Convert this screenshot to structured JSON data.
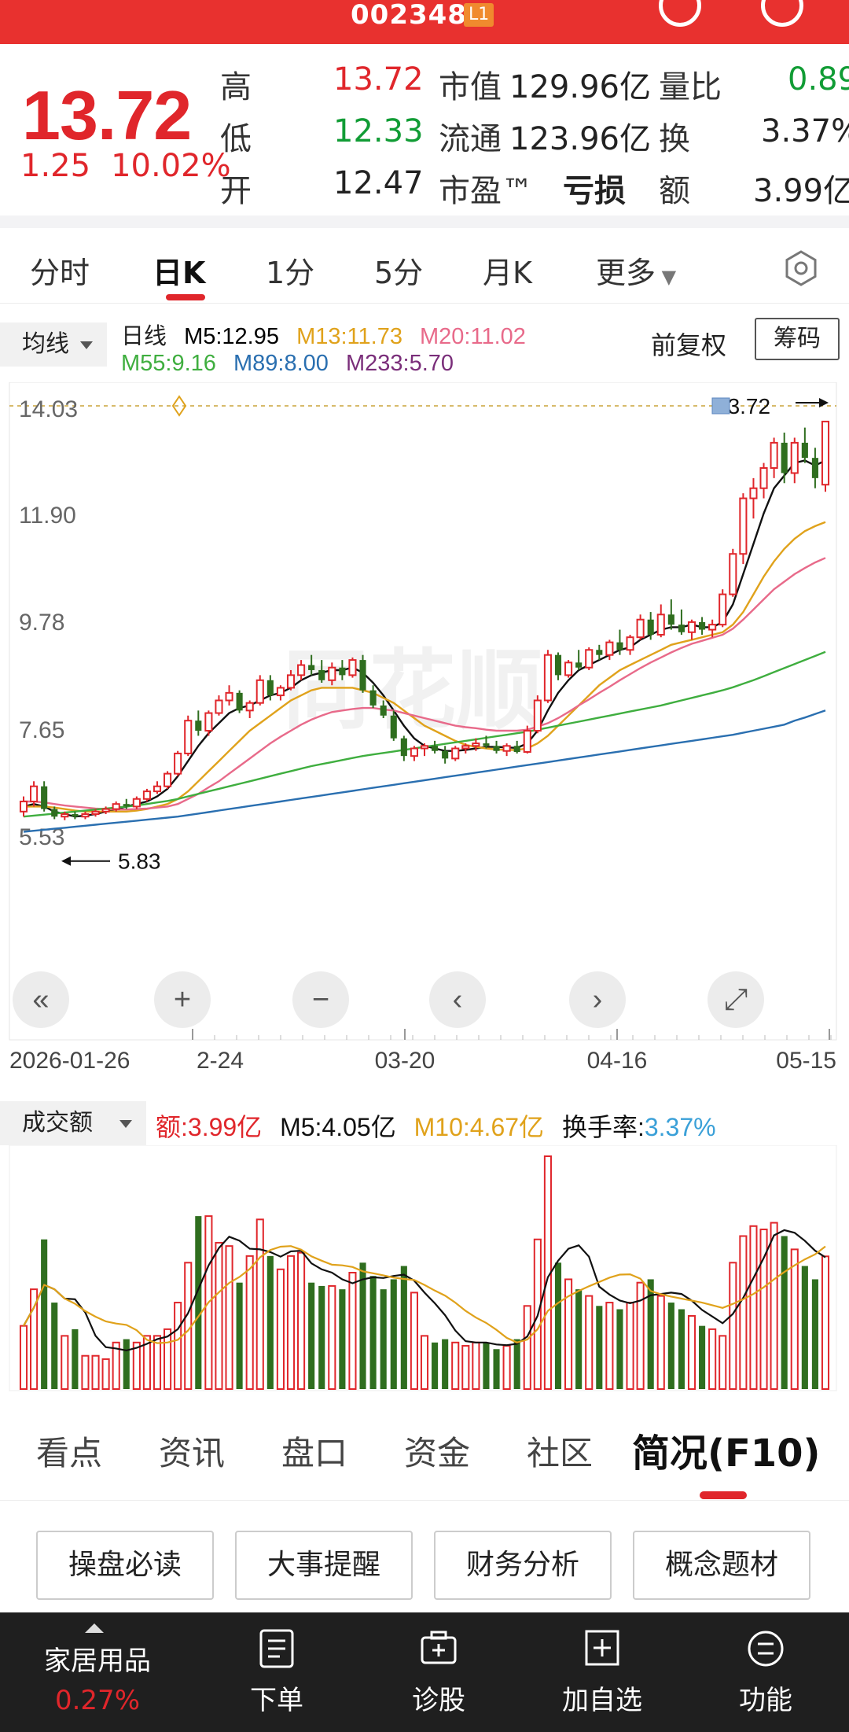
{
  "header": {
    "code": "002348",
    "level_badge": "L1"
  },
  "quote": {
    "price": "13.72",
    "change": "1.25",
    "change_pct": "10.02%",
    "rows": [
      {
        "l1": "高",
        "v1": "13.72",
        "l2": "市值",
        "v2": "129.96亿",
        "l3": "量比",
        "v3": "0.89"
      },
      {
        "l1": "低",
        "v1": "12.33",
        "l2": "流通",
        "v2": "123.96亿",
        "l3": "换",
        "v3": "3.37%"
      },
      {
        "l1": "开",
        "v1": "12.47",
        "l2": "市盈™",
        "v2": "亏损",
        "l3": "额",
        "v3": "3.99亿"
      }
    ]
  },
  "tabs": [
    "分时",
    "日K",
    "1分",
    "5分",
    "月K",
    "更多"
  ],
  "active_tab": "日K",
  "chart_header": {
    "indicator_dropdown": "均线",
    "period_label": "日线",
    "ma": [
      {
        "label": "M5:12.95",
        "color": "#111111"
      },
      {
        "label": "M13:11.73",
        "color": "#e0a21b"
      },
      {
        "label": "M20:11.02",
        "color": "#e86a8a"
      },
      {
        "label": "M55:9.16",
        "color": "#3fae3f"
      },
      {
        "label": "M89:8.00",
        "color": "#2a6fb0"
      },
      {
        "label": "M233:5.70",
        "color": "#7a2e7a"
      }
    ],
    "adjust": "前复权",
    "chips_button": "筹码"
  },
  "chart_data": {
    "type": "candlestick",
    "y_ticks": [
      "14.03",
      "11.90",
      "9.78",
      "7.65",
      "5.53"
    ],
    "x_ticks": [
      "2026-01-26",
      "2-24",
      "03-20",
      "04-16",
      "05-15"
    ],
    "high_label": "13.72",
    "low_label": "5.83",
    "watermark": "同花顺",
    "candles": [
      [
        6.0,
        6.3,
        5.9,
        6.2
      ],
      [
        6.2,
        6.6,
        6.1,
        6.5
      ],
      [
        6.5,
        6.6,
        6.0,
        6.05
      ],
      [
        6.05,
        6.1,
        5.85,
        5.9
      ],
      [
        5.9,
        6.0,
        5.83,
        5.95
      ],
      [
        5.95,
        6.0,
        5.85,
        5.9
      ],
      [
        5.9,
        6.0,
        5.85,
        5.95
      ],
      [
        5.95,
        6.05,
        5.9,
        6.0
      ],
      [
        6.0,
        6.1,
        5.95,
        6.05
      ],
      [
        6.05,
        6.2,
        6.0,
        6.15
      ],
      [
        6.15,
        6.25,
        6.05,
        6.1
      ],
      [
        6.1,
        6.3,
        6.05,
        6.25
      ],
      [
        6.25,
        6.45,
        6.2,
        6.4
      ],
      [
        6.4,
        6.6,
        6.35,
        6.5
      ],
      [
        6.5,
        6.8,
        6.45,
        6.75
      ],
      [
        6.75,
        7.2,
        6.7,
        7.15
      ],
      [
        7.15,
        7.9,
        7.1,
        7.8
      ],
      [
        7.8,
        8.0,
        7.5,
        7.6
      ],
      [
        7.6,
        8.0,
        7.5,
        7.95
      ],
      [
        7.95,
        8.3,
        7.9,
        8.2
      ],
      [
        8.2,
        8.5,
        8.1,
        8.35
      ],
      [
        8.35,
        8.4,
        7.95,
        8.0
      ],
      [
        8.0,
        8.2,
        7.85,
        8.15
      ],
      [
        8.15,
        8.7,
        8.1,
        8.6
      ],
      [
        8.6,
        8.7,
        8.2,
        8.3
      ],
      [
        8.3,
        8.5,
        8.2,
        8.45
      ],
      [
        8.45,
        8.8,
        8.4,
        8.7
      ],
      [
        8.7,
        9.0,
        8.6,
        8.9
      ],
      [
        8.9,
        9.1,
        8.7,
        8.8
      ],
      [
        8.8,
        9.0,
        8.55,
        8.6
      ],
      [
        8.6,
        8.95,
        8.5,
        8.85
      ],
      [
        8.85,
        9.0,
        8.6,
        8.7
      ],
      [
        8.7,
        9.05,
        8.65,
        9.0
      ],
      [
        9.0,
        9.1,
        8.35,
        8.4
      ],
      [
        8.4,
        8.5,
        8.05,
        8.1
      ],
      [
        8.1,
        8.2,
        7.85,
        7.9
      ],
      [
        7.9,
        8.0,
        7.4,
        7.45
      ],
      [
        7.45,
        7.5,
        7.0,
        7.1
      ],
      [
        7.1,
        7.3,
        7.0,
        7.25
      ],
      [
        7.25,
        7.35,
        7.1,
        7.3
      ],
      [
        7.3,
        7.4,
        7.15,
        7.2
      ],
      [
        7.2,
        7.3,
        6.95,
        7.05
      ],
      [
        7.05,
        7.3,
        7.0,
        7.25
      ],
      [
        7.25,
        7.35,
        7.15,
        7.3
      ],
      [
        7.3,
        7.45,
        7.2,
        7.35
      ],
      [
        7.35,
        7.5,
        7.25,
        7.3
      ],
      [
        7.3,
        7.4,
        7.15,
        7.2
      ],
      [
        7.2,
        7.35,
        7.1,
        7.3
      ],
      [
        7.3,
        7.4,
        7.15,
        7.18
      ],
      [
        7.18,
        7.7,
        7.15,
        7.6
      ],
      [
        7.6,
        8.3,
        7.55,
        8.2
      ],
      [
        8.2,
        9.2,
        8.15,
        9.1
      ],
      [
        9.1,
        9.15,
        8.6,
        8.7
      ],
      [
        8.7,
        9.0,
        8.65,
        8.95
      ],
      [
        8.95,
        9.2,
        8.8,
        8.85
      ],
      [
        8.85,
        9.25,
        8.8,
        9.2
      ],
      [
        9.2,
        9.3,
        9.0,
        9.1
      ],
      [
        9.1,
        9.4,
        9.0,
        9.35
      ],
      [
        9.35,
        9.6,
        9.1,
        9.2
      ],
      [
        9.2,
        9.5,
        9.1,
        9.45
      ],
      [
        9.45,
        9.9,
        9.4,
        9.8
      ],
      [
        9.8,
        9.95,
        9.4,
        9.5
      ],
      [
        9.5,
        10.1,
        9.45,
        9.9
      ],
      [
        9.9,
        10.2,
        9.6,
        9.7
      ],
      [
        9.7,
        10.0,
        9.5,
        9.55
      ],
      [
        9.55,
        9.8,
        9.4,
        9.75
      ],
      [
        9.75,
        9.85,
        9.5,
        9.6
      ],
      [
        9.6,
        9.8,
        9.45,
        9.7
      ],
      [
        9.7,
        10.4,
        9.65,
        10.3
      ],
      [
        10.3,
        11.2,
        10.25,
        11.1
      ],
      [
        11.1,
        12.3,
        10.9,
        12.2
      ],
      [
        12.2,
        12.6,
        11.8,
        12.4
      ],
      [
        12.4,
        12.9,
        12.2,
        12.8
      ],
      [
        12.8,
        13.4,
        12.6,
        13.3
      ],
      [
        13.3,
        13.5,
        12.5,
        12.7
      ],
      [
        12.7,
        13.4,
        12.5,
        13.3
      ],
      [
        13.3,
        13.6,
        12.9,
        13.0
      ],
      [
        13.0,
        13.2,
        12.4,
        12.6
      ],
      [
        12.47,
        13.72,
        12.33,
        13.72
      ]
    ],
    "ma_series": {
      "M5": [
        6.1,
        6.15,
        6.1,
        6.0,
        5.95,
        5.9,
        5.92,
        5.95,
        6.0,
        6.05,
        6.1,
        6.15,
        6.2,
        6.3,
        6.45,
        6.7,
        7.0,
        7.3,
        7.55,
        7.75,
        7.95,
        8.05,
        8.1,
        8.2,
        8.3,
        8.35,
        8.45,
        8.6,
        8.7,
        8.75,
        8.8,
        8.8,
        8.85,
        8.75,
        8.55,
        8.3,
        8.0,
        7.7,
        7.45,
        7.3,
        7.25,
        7.2,
        7.2,
        7.22,
        7.25,
        7.28,
        7.28,
        7.27,
        7.26,
        7.35,
        7.6,
        8.0,
        8.35,
        8.6,
        8.8,
        8.9,
        9.0,
        9.1,
        9.2,
        9.25,
        9.4,
        9.5,
        9.6,
        9.65,
        9.65,
        9.7,
        9.65,
        9.65,
        9.75,
        10.1,
        10.7,
        11.3,
        11.9,
        12.4,
        12.65,
        12.9,
        12.95,
        12.85,
        12.95
      ],
      "M13": [
        6.1,
        6.1,
        6.1,
        6.08,
        6.05,
        6.02,
        6.0,
        6.0,
        6.0,
        6.0,
        6.0,
        6.02,
        6.05,
        6.1,
        6.15,
        6.25,
        6.4,
        6.6,
        6.8,
        7.0,
        7.2,
        7.4,
        7.6,
        7.75,
        7.9,
        8.05,
        8.2,
        8.3,
        8.4,
        8.45,
        8.45,
        8.45,
        8.45,
        8.4,
        8.35,
        8.25,
        8.15,
        8.0,
        7.85,
        7.7,
        7.6,
        7.5,
        7.4,
        7.32,
        7.28,
        7.25,
        7.23,
        7.22,
        7.22,
        7.25,
        7.35,
        7.5,
        7.7,
        7.9,
        8.1,
        8.3,
        8.5,
        8.65,
        8.8,
        8.9,
        9.0,
        9.1,
        9.2,
        9.3,
        9.35,
        9.4,
        9.45,
        9.5,
        9.55,
        9.7,
        9.95,
        10.3,
        10.65,
        10.95,
        11.2,
        11.4,
        11.55,
        11.65,
        11.73
      ],
      "M20": [
        6.2,
        6.2,
        6.18,
        6.15,
        6.12,
        6.1,
        6.08,
        6.06,
        6.05,
        6.04,
        6.04,
        6.05,
        6.06,
        6.08,
        6.1,
        6.15,
        6.25,
        6.35,
        6.48,
        6.6,
        6.75,
        6.9,
        7.05,
        7.2,
        7.35,
        7.48,
        7.6,
        7.72,
        7.82,
        7.9,
        7.97,
        8.0,
        8.03,
        8.05,
        8.05,
        8.02,
        8.0,
        7.95,
        7.9,
        7.85,
        7.8,
        7.75,
        7.7,
        7.67,
        7.65,
        7.62,
        7.6,
        7.6,
        7.6,
        7.62,
        7.68,
        7.75,
        7.85,
        7.97,
        8.1,
        8.22,
        8.35,
        8.47,
        8.6,
        8.72,
        8.84,
        8.95,
        9.05,
        9.15,
        9.24,
        9.32,
        9.38,
        9.44,
        9.5,
        9.62,
        9.8,
        10.0,
        10.2,
        10.4,
        10.55,
        10.7,
        10.82,
        10.93,
        11.02
      ],
      "M55": [
        5.9,
        5.92,
        5.94,
        5.96,
        5.98,
        6.0,
        6.02,
        6.04,
        6.06,
        6.08,
        6.1,
        6.12,
        6.15,
        6.18,
        6.21,
        6.25,
        6.3,
        6.35,
        6.4,
        6.45,
        6.5,
        6.55,
        6.6,
        6.65,
        6.7,
        6.75,
        6.8,
        6.85,
        6.9,
        6.94,
        6.98,
        7.02,
        7.06,
        7.1,
        7.13,
        7.16,
        7.19,
        7.22,
        7.25,
        7.28,
        7.31,
        7.34,
        7.37,
        7.4,
        7.43,
        7.46,
        7.49,
        7.52,
        7.55,
        7.58,
        7.62,
        7.66,
        7.7,
        7.74,
        7.78,
        7.82,
        7.86,
        7.9,
        7.94,
        7.98,
        8.02,
        8.06,
        8.1,
        8.15,
        8.2,
        8.25,
        8.3,
        8.35,
        8.4,
        8.46,
        8.53,
        8.6,
        8.68,
        8.76,
        8.84,
        8.92,
        9.0,
        9.08,
        9.16
      ],
      "M89": [
        5.6,
        5.62,
        5.64,
        5.66,
        5.68,
        5.7,
        5.72,
        5.74,
        5.76,
        5.78,
        5.8,
        5.82,
        5.84,
        5.86,
        5.88,
        5.9,
        5.93,
        5.96,
        5.99,
        6.02,
        6.05,
        6.08,
        6.11,
        6.14,
        6.17,
        6.2,
        6.23,
        6.26,
        6.29,
        6.32,
        6.35,
        6.38,
        6.41,
        6.44,
        6.47,
        6.5,
        6.53,
        6.56,
        6.59,
        6.62,
        6.65,
        6.68,
        6.71,
        6.74,
        6.77,
        6.8,
        6.83,
        6.86,
        6.89,
        6.92,
        6.95,
        6.98,
        7.01,
        7.04,
        7.07,
        7.1,
        7.13,
        7.16,
        7.19,
        7.22,
        7.25,
        7.28,
        7.31,
        7.34,
        7.37,
        7.4,
        7.43,
        7.46,
        7.49,
        7.52,
        7.56,
        7.6,
        7.64,
        7.68,
        7.72,
        7.8,
        7.86,
        7.93,
        8.0
      ]
    },
    "volume": {
      "label": "成交额",
      "amount_label": "额:3.99亿",
      "m5_label": "M5:4.05亿",
      "m10_label": "M10:4.67亿",
      "turnover_label": "换手率:",
      "turnover_value": "3.37%",
      "values": [
        1.9,
        3.0,
        4.5,
        2.6,
        1.6,
        1.8,
        1.0,
        1.0,
        0.9,
        1.4,
        1.5,
        1.4,
        1.6,
        1.6,
        1.8,
        2.6,
        3.8,
        5.2,
        5.2,
        4.4,
        4.3,
        3.2,
        4.0,
        5.1,
        4.0,
        3.6,
        4.0,
        4.1,
        3.2,
        3.1,
        3.1,
        3.0,
        3.5,
        3.8,
        3.4,
        3.0,
        3.3,
        3.7,
        2.9,
        1.6,
        1.4,
        1.5,
        1.4,
        1.3,
        1.4,
        1.4,
        1.2,
        1.3,
        1.5,
        2.5,
        4.5,
        7.0,
        3.8,
        3.3,
        3.0,
        2.8,
        2.5,
        2.6,
        2.4,
        2.6,
        3.2,
        3.3,
        2.8,
        2.6,
        2.4,
        2.2,
        1.9,
        1.8,
        1.6,
        3.8,
        4.6,
        4.9,
        4.8,
        5.0,
        4.6,
        4.2,
        3.7,
        3.3,
        3.99
      ]
    }
  },
  "chart_controls": [
    "«",
    "+",
    "−",
    "‹",
    "›",
    "⤢"
  ],
  "sections": [
    "看点",
    "资讯",
    "盘口",
    "资金",
    "社区",
    "简况(F10)"
  ],
  "active_section": "简况(F10)",
  "f10_buttons": [
    "操盘必读",
    "大事提醒",
    "财务分析",
    "概念题材"
  ],
  "bottom_nav": {
    "sector_name": "家居用品",
    "sector_change": "0.27%",
    "items": [
      "下单",
      "诊股",
      "加自选",
      "功能"
    ]
  }
}
